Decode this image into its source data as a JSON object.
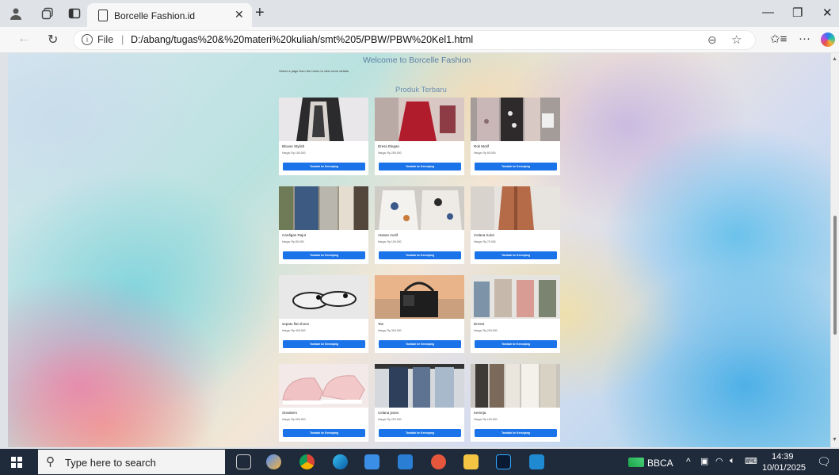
{
  "browser": {
    "tab_title": "Borcelle Fashion.id",
    "address_label": "File",
    "url": "D:/abang/tugas%20&%20materi%20kuliah/smt%205/PBW/PBW%20Kel1.html"
  },
  "page": {
    "welcome": "Welcome to Borcelle Fashion",
    "hint": "Select a page from the menu to view more details.",
    "section_title": "Produk Terbaru",
    "products": [
      {
        "name": "Blouse Stylish",
        "price": "Harga: Rp 150.000",
        "button": "Tambah ke Keranjang"
      },
      {
        "name": "Dress Elegan",
        "price": "Harga: Rp 250.000",
        "button": "Tambah ke Keranjang"
      },
      {
        "name": "Rok Motif",
        "price": "Harga: Rp 50.000",
        "button": "Tambah ke Keranjang"
      },
      {
        "name": "Cardigan Rajut",
        "price": "Harga: Rp 80.000",
        "button": "Tambah ke Keranjang"
      },
      {
        "name": "Atasan motif",
        "price": "Harga: Rp 100.000",
        "button": "Tambah ke Keranjang"
      },
      {
        "name": "Celana Kulot",
        "price": "Harga: Rp 70.000",
        "button": "Tambah ke Keranjang"
      },
      {
        "name": "sepatu flat shoes",
        "price": "Harga: Rp 400.000",
        "button": "Tambah ke Keranjang"
      },
      {
        "name": "Tas",
        "price": "Harga: Rp 300.000",
        "button": "Tambah ke Keranjang"
      },
      {
        "name": "Dreset",
        "price": "Harga: Rp 200.000",
        "button": "Tambah ke Keranjang"
      },
      {
        "name": "Sneakers",
        "price": "Harga: Rp 600.000",
        "button": "Tambah ke Keranjang"
      },
      {
        "name": "Celana jeans",
        "price": "Harga: Rp 200.000",
        "button": "Tambah ke Keranjang"
      },
      {
        "name": "Kemeja",
        "price": "Harga: Rp 100.000",
        "button": "Tambah ke Keranjang"
      }
    ]
  },
  "taskbar": {
    "search_placeholder": "Type here to search",
    "stock_ticker": "BBCA",
    "time": "14:39",
    "date": "10/01/2025"
  }
}
